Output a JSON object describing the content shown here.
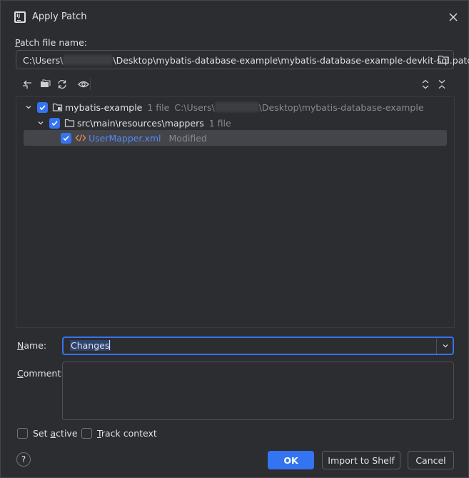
{
  "window": {
    "title": "Apply Patch"
  },
  "patch": {
    "label_first": "P",
    "label_rest": "atch file name:",
    "path_prefix": "C:\\Users\\",
    "path_suffix": "\\Desktop\\mybatis-database-example\\mybatis-database-example-devkit-sql.patch"
  },
  "tree": {
    "root": {
      "name": "mybatis-example",
      "count": "1 file",
      "path_prefix": "C:\\Users\\",
      "path_suffix": "\\Desktop\\mybatis-database-example"
    },
    "dir": {
      "name": "src\\main\\resources\\mappers",
      "count": "1 file"
    },
    "file": {
      "name": "UserMapper.xml",
      "status": "Modified"
    }
  },
  "form": {
    "name_label_first": "N",
    "name_label_rest": "ame:",
    "name_value": "Changes",
    "comment_label_first": "C",
    "comment_label_rest": "omment:"
  },
  "options": {
    "set_active_pre": "Set ",
    "set_active_ul": "a",
    "set_active_post": "ctive",
    "track_context_ul": "T",
    "track_context_post": "rack context"
  },
  "buttons": {
    "help": "?",
    "ok": "OK",
    "import": "Import to Shelf",
    "cancel": "Cancel"
  },
  "colors": {
    "accent": "#3574f0",
    "link": "#548af7",
    "background": "#2b2d30"
  }
}
